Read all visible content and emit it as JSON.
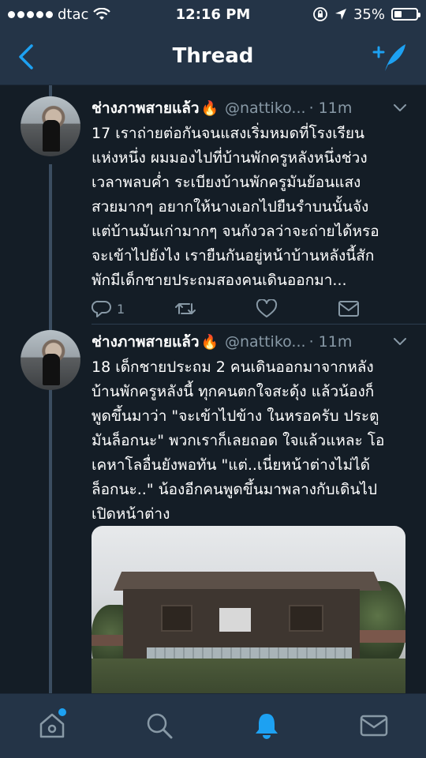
{
  "status_bar": {
    "carrier": "dtac",
    "time": "12:16 PM",
    "battery_percent_label": "35%",
    "battery_level": 0.35
  },
  "nav": {
    "title": "Thread"
  },
  "tweets": [
    {
      "name": "ช่างภาพสายแล้ว",
      "emoji": "🔥",
      "handle": "@nattiko...",
      "time": "· 11m",
      "text": "17 เราถ่ายต่อกันจนแสงเริ่มหมดที่โรงเรียน\nแห่งหนึ่ง ผมมองไปที่บ้านพักครูหลังหนึ่งช่วง\nเวลาพลบค่ำ ระเบียงบ้านพักครูมันย้อนแสง\nสวยมากๆ อยากให้นางเอกไปยืนรำบนนั้นจัง\nแต่บ้านมันเก่ามากๆ จนกังวลว่าจะถ่ายได้หรอ\nจะเข้าไปยังไง เรายืนกันอยู่หน้าบ้านหลังนี้สัก\nพักมีเด็กชายประถมสองคนเดินออกมา...",
      "reply_count": "1"
    },
    {
      "name": "ช่างภาพสายแล้ว",
      "emoji": "🔥",
      "handle": "@nattiko...",
      "time": "· 11m",
      "text": "18 เด็กชายประถม 2 คนเดินออกมาจากหลัง\nบ้านพักครูหลังนี้ ทุกคนตกใจสะดุ้ง แล้วน้องก็\nพูดขึ้นมาว่า \"จะเข้าไปข้าง ในหรอครับ ประตู\nมันล็อกนะ\" พวกเราก็เลยถอด ใจแล้วแหละ โอ\nเคหาโลอื่นยังพอทัน  \"แต่..เนี่ยหน้าต่างไม่ได้\nล็อกนะ..\" น้องอีกคนพูดขึ้นมาพลางกับเดินไป\nเปิดหน้าต่าง"
    }
  ],
  "colors": {
    "background": "#141d26",
    "bars": "#243447",
    "accent": "#1da1f2",
    "secondary_text": "#8899a6"
  },
  "icons": {
    "back": "chevron-left-icon",
    "compose": "compose-tweet-icon",
    "reply": "reply-icon",
    "retweet": "retweet-icon",
    "like": "heart-icon",
    "dm": "envelope-icon",
    "more": "chevron-down-icon",
    "tab_home": "home-icon",
    "tab_search": "search-icon",
    "tab_notifications": "bell-icon",
    "tab_messages": "mail-icon"
  }
}
